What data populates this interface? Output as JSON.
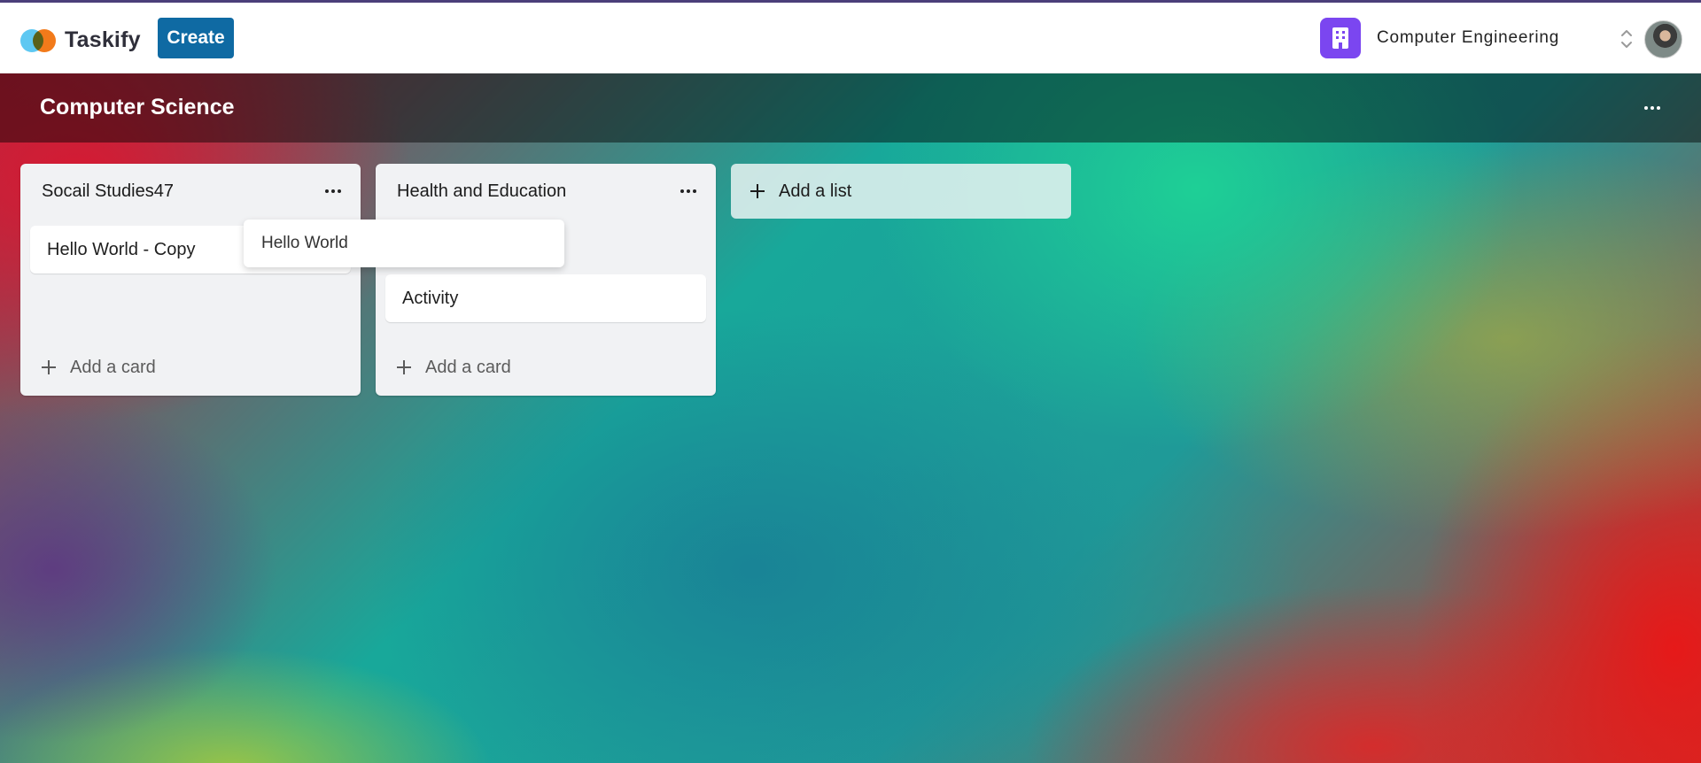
{
  "app": {
    "name": "Taskify",
    "create_label": "Create"
  },
  "organization": {
    "name": "Computer Engineering",
    "icon": "building-icon",
    "accent_color": "#7b46f0"
  },
  "board": {
    "title": "Computer Science",
    "menu_icon": "more-horizontal-icon",
    "lists": [
      {
        "title": "Socail Studies47",
        "cards": [
          "Hello World - Copy"
        ],
        "add_card_label": "Add a card"
      },
      {
        "title": "Health and Education",
        "cards": [
          "Activity"
        ],
        "add_card_label": "Add a card"
      }
    ],
    "add_list_label": "Add a list",
    "dragging_card": "Hello World"
  },
  "colors": {
    "primary_button": "#0f6aa3",
    "list_background": "#f1f2f4"
  }
}
